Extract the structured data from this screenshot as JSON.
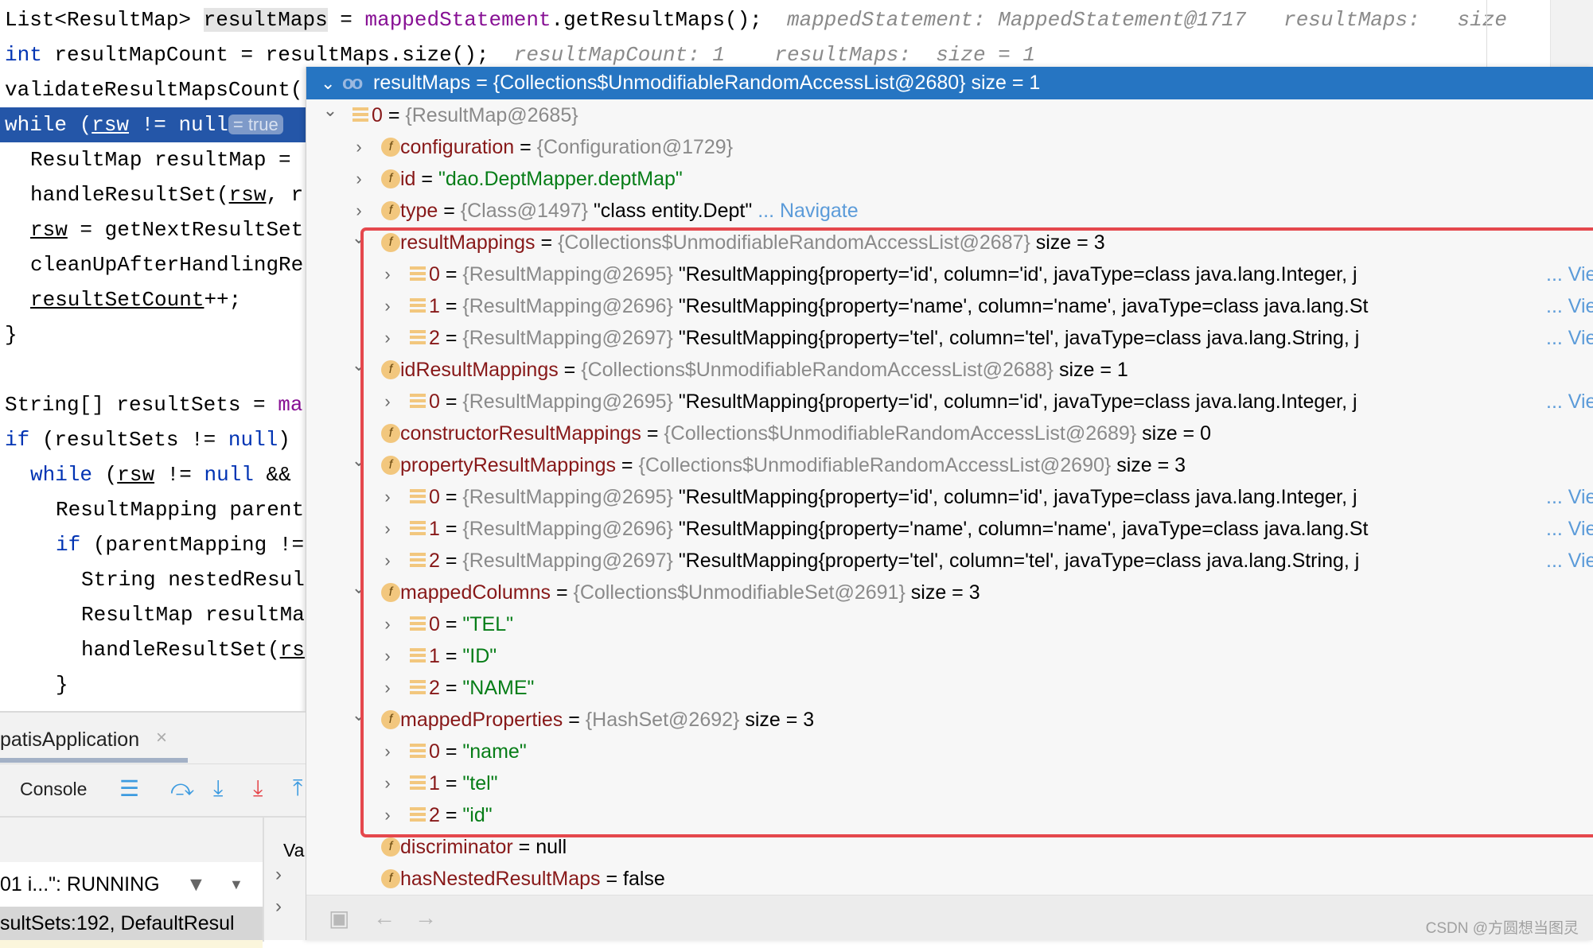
{
  "editor": {
    "lines": [
      {
        "indent": 0,
        "segs": [
          [
            "List<ResultMap> ",
            ""
          ],
          [
            "resultMaps",
            "sel"
          ],
          [
            " = ",
            ""
          ],
          [
            "mappedStatement",
            "fn"
          ],
          [
            ".getResultMaps();",
            ""
          ],
          [
            "  mappedStatement: MappedStatement@1717   resultMaps: ",
            "hint"
          ],
          [
            "  size",
            "hint"
          ]
        ]
      },
      {
        "indent": 0,
        "segs": [
          [
            "int",
            "kw"
          ],
          [
            " resultMapCount = resultMaps.size();",
            ""
          ],
          [
            "  resultMapCount: 1    resultMaps:  size = 1",
            "hint"
          ]
        ]
      },
      {
        "indent": 0,
        "segs": [
          [
            "validateResultMapsCount(",
            ""
          ]
        ]
      },
      {
        "indent": 0,
        "hl": true,
        "segs": [
          [
            "while (",
            ""
          ],
          [
            "rsw",
            "ul"
          ],
          [
            " != null",
            ""
          ],
          [
            "= true",
            "pill"
          ]
        ]
      },
      {
        "indent": 2,
        "segs": [
          [
            "ResultMap resultMap = ",
            ""
          ]
        ]
      },
      {
        "indent": 2,
        "segs": [
          [
            "handleResultSet(",
            ""
          ],
          [
            "rsw",
            "ul"
          ],
          [
            ", r",
            ""
          ]
        ]
      },
      {
        "indent": 2,
        "segs": [
          [
            "rsw",
            "ul"
          ],
          [
            " = getNextResultSet",
            ""
          ]
        ]
      },
      {
        "indent": 2,
        "segs": [
          [
            "cleanUpAfterHandlingRe",
            ""
          ]
        ]
      },
      {
        "indent": 2,
        "segs": [
          [
            "resultSetCount",
            "ul"
          ],
          [
            "++;",
            ""
          ]
        ]
      },
      {
        "indent": 0,
        "segs": [
          [
            "}",
            ""
          ]
        ]
      },
      {
        "indent": 0,
        "segs": []
      },
      {
        "indent": 0,
        "segs": [
          [
            "String[] resultSets = ",
            ""
          ],
          [
            "ma",
            "fn"
          ]
        ]
      },
      {
        "indent": 0,
        "segs": [
          [
            "if",
            "kw"
          ],
          [
            " (resultSets != ",
            ""
          ],
          [
            "null",
            "kw"
          ],
          [
            ")",
            ""
          ]
        ]
      },
      {
        "indent": 2,
        "segs": [
          [
            "while",
            "kw"
          ],
          [
            " (",
            ""
          ],
          [
            "rsw",
            "ul"
          ],
          [
            " != ",
            ""
          ],
          [
            "null",
            "kw"
          ],
          [
            " &&",
            ""
          ]
        ]
      },
      {
        "indent": 4,
        "segs": [
          [
            "ResultMapping parent",
            ""
          ]
        ]
      },
      {
        "indent": 4,
        "segs": [
          [
            "if",
            "kw"
          ],
          [
            " (parentMapping !=",
            ""
          ]
        ]
      },
      {
        "indent": 6,
        "segs": [
          [
            "String nestedResul",
            ""
          ]
        ]
      },
      {
        "indent": 6,
        "segs": [
          [
            "ResultMap resultMa",
            ""
          ]
        ]
      },
      {
        "indent": 6,
        "segs": [
          [
            "handleResultSet(",
            ""
          ],
          [
            "rs",
            "ul"
          ]
        ]
      },
      {
        "indent": 4,
        "segs": [
          [
            "}",
            ""
          ]
        ]
      }
    ]
  },
  "popup": {
    "header": {
      "glyph": "oo",
      "text": "resultMaps = {Collections$UnmodifiableRandomAccessList@2680}  size = 1"
    },
    "rows": [
      {
        "level": 1,
        "tw": "open",
        "icon": "list",
        "name": "0",
        "ref": "{ResultMap@2685}"
      },
      {
        "level": 2,
        "tw": "closed",
        "icon": "field",
        "name": "configuration",
        "ref": "{Configuration@1729}"
      },
      {
        "level": 2,
        "tw": "closed",
        "icon": "field",
        "name": "id",
        "str": "\"dao.DeptMapper.deptMap\""
      },
      {
        "level": 2,
        "tw": "closed",
        "icon": "field",
        "name": "type",
        "ref": "{Class@1497}",
        "val": "\"class entity.Dept\"",
        "link": "... Navigate"
      },
      {
        "level": 2,
        "tw": "open",
        "icon": "field",
        "name": "resultMappings",
        "ref": "{Collections$UnmodifiableRandomAccessList@2687}",
        "val": " size = 3"
      },
      {
        "level": 3,
        "tw": "closed",
        "icon": "list",
        "name": "0",
        "ref": "{ResultMapping@2695}",
        "val": "\"ResultMapping{property='id', column='id', javaType=class java.lang.Integer, j",
        "link": "... View"
      },
      {
        "level": 3,
        "tw": "closed",
        "icon": "list",
        "name": "1",
        "ref": "{ResultMapping@2696}",
        "val": "\"ResultMapping{property='name', column='name', javaType=class java.lang.St",
        "link": "... View"
      },
      {
        "level": 3,
        "tw": "closed",
        "icon": "list",
        "name": "2",
        "ref": "{ResultMapping@2697}",
        "val": "\"ResultMapping{property='tel', column='tel', javaType=class java.lang.String, j",
        "link": "... View"
      },
      {
        "level": 2,
        "tw": "open",
        "icon": "field",
        "name": "idResultMappings",
        "ref": "{Collections$UnmodifiableRandomAccessList@2688}",
        "val": " size = 1"
      },
      {
        "level": 3,
        "tw": "closed",
        "icon": "list",
        "name": "0",
        "ref": "{ResultMapping@2695}",
        "val": "\"ResultMapping{property='id', column='id', javaType=class java.lang.Integer, j",
        "link": "... View"
      },
      {
        "level": 2,
        "tw": "none",
        "icon": "field",
        "name": "constructorResultMappings",
        "ref": "{Collections$UnmodifiableRandomAccessList@2689}",
        "val": " size = 0"
      },
      {
        "level": 2,
        "tw": "open",
        "icon": "field",
        "name": "propertyResultMappings",
        "ref": "{Collections$UnmodifiableRandomAccessList@2690}",
        "val": " size = 3"
      },
      {
        "level": 3,
        "tw": "closed",
        "icon": "list",
        "name": "0",
        "ref": "{ResultMapping@2695}",
        "val": "\"ResultMapping{property='id', column='id', javaType=class java.lang.Integer, j",
        "link": "... View"
      },
      {
        "level": 3,
        "tw": "closed",
        "icon": "list",
        "name": "1",
        "ref": "{ResultMapping@2696}",
        "val": "\"ResultMapping{property='name', column='name', javaType=class java.lang.St",
        "link": "... View"
      },
      {
        "level": 3,
        "tw": "closed",
        "icon": "list",
        "name": "2",
        "ref": "{ResultMapping@2697}",
        "val": "\"ResultMapping{property='tel', column='tel', javaType=class java.lang.String, j",
        "link": "... View"
      },
      {
        "level": 2,
        "tw": "open",
        "icon": "field",
        "name": "mappedColumns",
        "ref": "{Collections$UnmodifiableSet@2691}",
        "val": " size = 3"
      },
      {
        "level": 3,
        "tw": "closed",
        "icon": "list",
        "name": "0",
        "str": "\"TEL\""
      },
      {
        "level": 3,
        "tw": "closed",
        "icon": "list",
        "name": "1",
        "str": "\"ID\""
      },
      {
        "level": 3,
        "tw": "closed",
        "icon": "list",
        "name": "2",
        "str": "\"NAME\""
      },
      {
        "level": 2,
        "tw": "open",
        "icon": "field",
        "name": "mappedProperties",
        "ref": "{HashSet@2692}",
        "val": " size = 3"
      },
      {
        "level": 3,
        "tw": "closed",
        "icon": "list",
        "name": "0",
        "str": "\"name\""
      },
      {
        "level": 3,
        "tw": "closed",
        "icon": "list",
        "name": "1",
        "str": "\"tel\""
      },
      {
        "level": 3,
        "tw": "closed",
        "icon": "list",
        "name": "2",
        "str": "\"id\""
      },
      {
        "level": 2,
        "tw": "none",
        "icon": "field",
        "name": "discriminator",
        "val": "null"
      },
      {
        "level": 2,
        "tw": "none",
        "icon": "field",
        "name": "hasNestedResultMaps",
        "val": "false"
      }
    ],
    "watermark": "CSDN @方圆想当图灵"
  },
  "debug": {
    "tab_label": "patisApplication",
    "console_label": "Console",
    "variables_header": "Va",
    "thread_status": "01 i...\": RUNNING",
    "frame": "sultSets:192, DefaultResul"
  },
  "colors": {
    "highlight_box": "#e5484d",
    "header_bg": "#2675c2",
    "field_name": "#871818",
    "string": "#067d17",
    "link": "#5b9bd9"
  }
}
